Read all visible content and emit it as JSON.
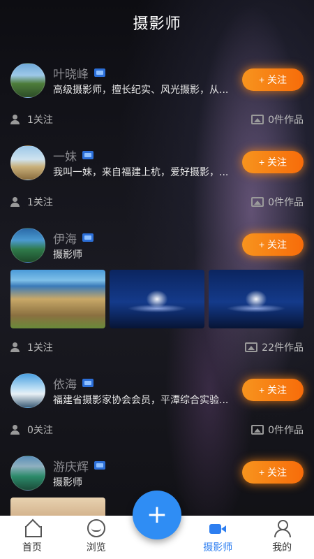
{
  "header": {
    "title": "摄影师"
  },
  "photographers": [
    {
      "name": "叶晓峰",
      "desc": "高级摄影师，擅长纪实、风光摄影，从...",
      "follow_label": "+ 关注",
      "followers": "1关注",
      "works": "0件作品"
    },
    {
      "name": "一妹",
      "desc": "我叫一妹，来自福建上杭，爱好摄影，...",
      "follow_label": "+ 关注",
      "followers": "1关注",
      "works": "0件作品"
    },
    {
      "name": "伊海",
      "desc": "摄影师",
      "follow_label": "+ 关注",
      "followers": "1关注",
      "works": "22件作品"
    },
    {
      "name": "依海",
      "desc": "福建省摄影家协会会员，平潭综合实验...",
      "follow_label": "+ 关注",
      "followers": "0关注",
      "works": "0件作品"
    },
    {
      "name": "游庆辉",
      "desc": "摄影师",
      "follow_label": "+ 关注"
    }
  ],
  "fab": {
    "label": "+"
  },
  "tabbar": {
    "home": "首页",
    "browse": "浏览",
    "photographer": "摄影师",
    "mine": "我的"
  },
  "colors": {
    "accent": "#2d7ef0",
    "follow_orange": "#f7941e"
  }
}
